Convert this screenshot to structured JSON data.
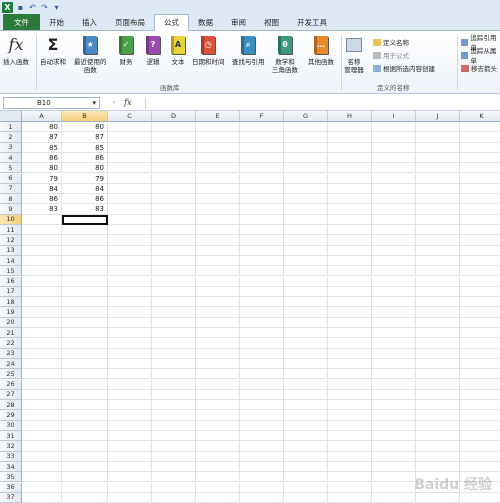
{
  "quick_access": {
    "app_icon": "X",
    "save_icon": "save-icon",
    "undo_icon": "undo-icon",
    "redo_icon": "redo-icon"
  },
  "tabs": [
    {
      "label": "文件"
    },
    {
      "label": "开始"
    },
    {
      "label": "插入"
    },
    {
      "label": "页面布局"
    },
    {
      "label": "公式"
    },
    {
      "label": "数据"
    },
    {
      "label": "审阅"
    },
    {
      "label": "视图"
    },
    {
      "label": "开发工具"
    }
  ],
  "ribbon": {
    "insert_function": {
      "label1": "插入函数",
      "glyph": "fx"
    },
    "autosum": {
      "label1": "自动求和",
      "glyph": "Σ"
    },
    "recent": {
      "label1": "最近使用的",
      "label2": "函数"
    },
    "financial": {
      "label1": "财务"
    },
    "logical": {
      "label1": "逻辑"
    },
    "text": {
      "label1": "文本"
    },
    "datetime": {
      "label1": "日期和时间"
    },
    "lookup": {
      "label1": "查找与引用"
    },
    "math": {
      "label1": "数学和",
      "label2": "三角函数"
    },
    "more": {
      "label1": "其他函数"
    },
    "library_label": "函数库",
    "name_manager": {
      "label1": "名称",
      "label2": "管理器"
    },
    "define_name": "定义名称",
    "use_in_formula": "用于公式",
    "create_from_selection": "根据所选内容创建",
    "defined_names_label": "定义的名称",
    "trace_precedents": "追踪引用单",
    "trace_dependents": "追踪从属单",
    "remove_arrows": "移去箭头"
  },
  "formula_bar": {
    "name_box": "B10",
    "fx": "fx",
    "formula": ""
  },
  "columns": [
    "A",
    "B",
    "C",
    "D",
    "E",
    "F",
    "G",
    "H",
    "I",
    "J",
    "K"
  ],
  "rows": [
    "1",
    "2",
    "3",
    "4",
    "5",
    "6",
    "7",
    "8",
    "9",
    "10",
    "11",
    "12",
    "13",
    "14",
    "15",
    "16",
    "17",
    "18",
    "19",
    "20",
    "21",
    "22",
    "23",
    "24",
    "25",
    "26",
    "27",
    "28",
    "29",
    "30",
    "31",
    "32",
    "33",
    "34",
    "35",
    "36",
    "37"
  ],
  "cells": {
    "A": [
      "80",
      "87",
      "85",
      "86",
      "80",
      "79",
      "84",
      "86",
      "83"
    ],
    "B": [
      "80",
      "87",
      "85",
      "86",
      "80",
      "79",
      "84",
      "86",
      "83"
    ]
  },
  "watermark": "Baidu 经验"
}
